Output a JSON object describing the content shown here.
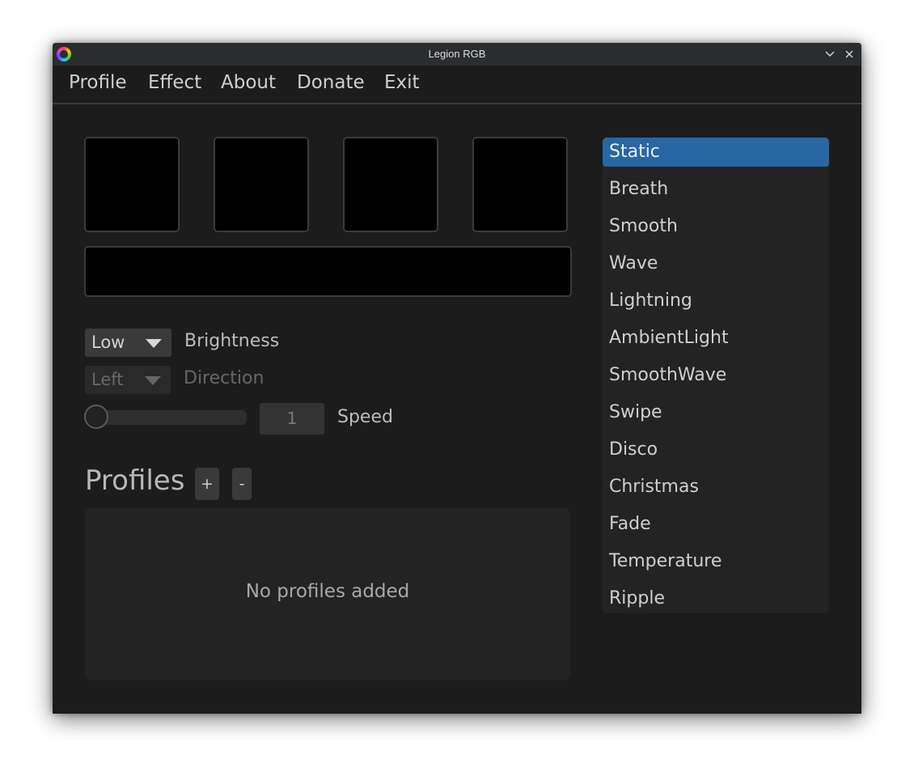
{
  "window": {
    "title": "Legion RGB"
  },
  "menu": {
    "items": [
      "Profile",
      "Effect",
      "About",
      "Donate",
      "Exit"
    ]
  },
  "controls": {
    "brightness": {
      "value": "Low",
      "label": "Brightness"
    },
    "direction": {
      "value": "Left",
      "label": "Direction",
      "enabled": false
    },
    "speed": {
      "value": "1",
      "label": "Speed",
      "slider_fraction": 0
    }
  },
  "profiles": {
    "title": "Profiles",
    "add_label": "+",
    "remove_label": "-",
    "empty_text": "No profiles added"
  },
  "effects": {
    "selected": "Static",
    "items": [
      "Static",
      "Breath",
      "Smooth",
      "Wave",
      "Lightning",
      "AmbientLight",
      "SmoothWave",
      "Swipe",
      "Disco",
      "Christmas",
      "Fade",
      "Temperature",
      "Ripple"
    ]
  },
  "colors": {
    "accent": "#2866a4",
    "background": "#1c1c1c",
    "swatch_1": "#000000",
    "swatch_2": "#000000",
    "swatch_3": "#000000",
    "swatch_4": "#000000"
  }
}
